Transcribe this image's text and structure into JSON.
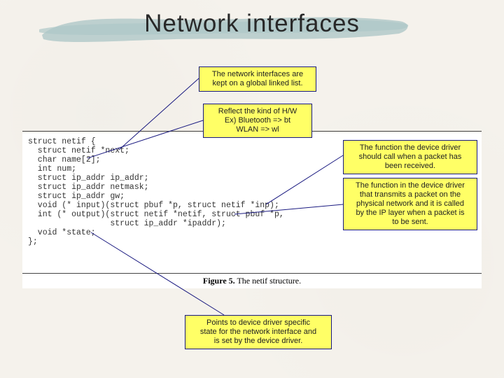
{
  "title": "Network interfaces",
  "code": "struct netif {\n  struct netif *next;\n  char name[2];\n  int num;\n  struct ip_addr ip_addr;\n  struct ip_addr netmask;\n  struct ip_addr gw;\n  void (* input)(struct pbuf *p, struct netif *inp);\n  int (* output)(struct netif *netif, struct pbuf *p,\n                 struct ip_addr *ipaddr);\n  void *state;\n};",
  "caption_prefix": "Figure 5.",
  "caption_text": "The netif structure.",
  "notes": {
    "linked_list": "The network interfaces are\nkept on a global linked list.",
    "hw_kind": "Reflect the kind of H/W\nEx) Bluetooth => bt\nWLAN => wl",
    "input_fn": "The function the device driver\nshould call when a packet has\nbeen received.",
    "output_fn": "The function in the device driver\nthat transmits a packet on the\nphysical network and it is called\nby the IP layer when a packet is\nto be sent.",
    "state_ptr": "Points to device driver specific\nstate for the network interface and\nis set by the device driver."
  }
}
